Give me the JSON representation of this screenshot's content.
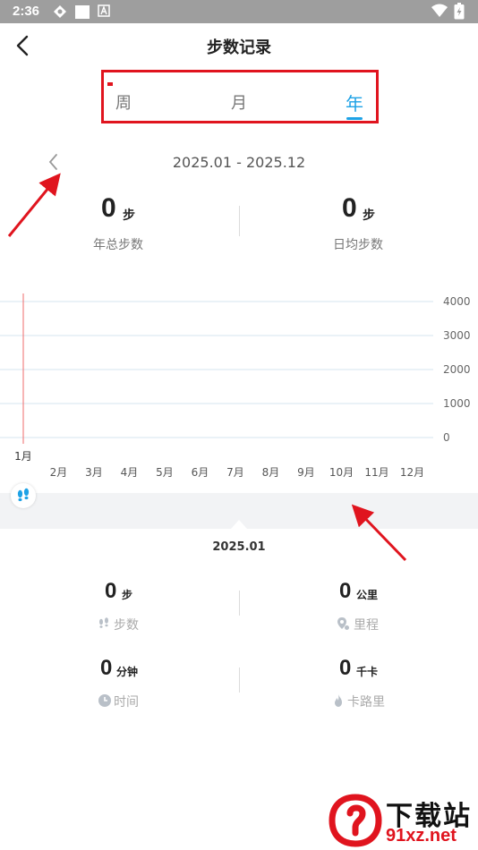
{
  "status_bar": {
    "time": "2:36"
  },
  "header": {
    "title": "步数记录"
  },
  "tabs": [
    {
      "label": "周",
      "active": false
    },
    {
      "label": "月",
      "active": false
    },
    {
      "label": "年",
      "active": true
    }
  ],
  "range": {
    "label": "2025.01 - 2025.12"
  },
  "summary": {
    "total_value": "0",
    "total_unit": "步",
    "total_caption": "年总步数",
    "avg_value": "0",
    "avg_unit": "步",
    "avg_caption": "日均步数"
  },
  "chart_data": {
    "type": "bar",
    "categories": [
      "1月",
      "2月",
      "3月",
      "4月",
      "5月",
      "6月",
      "7月",
      "8月",
      "9月",
      "10月",
      "11月",
      "12月"
    ],
    "values": [
      0,
      0,
      0,
      0,
      0,
      0,
      0,
      0,
      0,
      0,
      0,
      0
    ],
    "y_ticks": [
      "4000",
      "3000",
      "2000",
      "1000",
      "0"
    ],
    "ylim": [
      0,
      4000
    ],
    "y_axis_side": "right",
    "grid": true,
    "selected_category": "1月"
  },
  "detail": {
    "month": "2025.01",
    "steps_value": "0",
    "steps_unit": "步",
    "steps_caption": "步数",
    "distance_value": "0",
    "distance_unit": "公里",
    "distance_caption": "里程",
    "time_value": "0",
    "time_unit": "分钟",
    "time_caption": "时间",
    "calories_value": "0",
    "calories_unit": "千卡",
    "calories_caption": "卡路里"
  },
  "watermark": {
    "title": "下载站",
    "url": "91xz.net"
  },
  "colors": {
    "accent": "#1ea2e6",
    "annotation_red": "#e0141e",
    "grid": "#d6e4ef",
    "status_bar": "#9e9e9e"
  }
}
